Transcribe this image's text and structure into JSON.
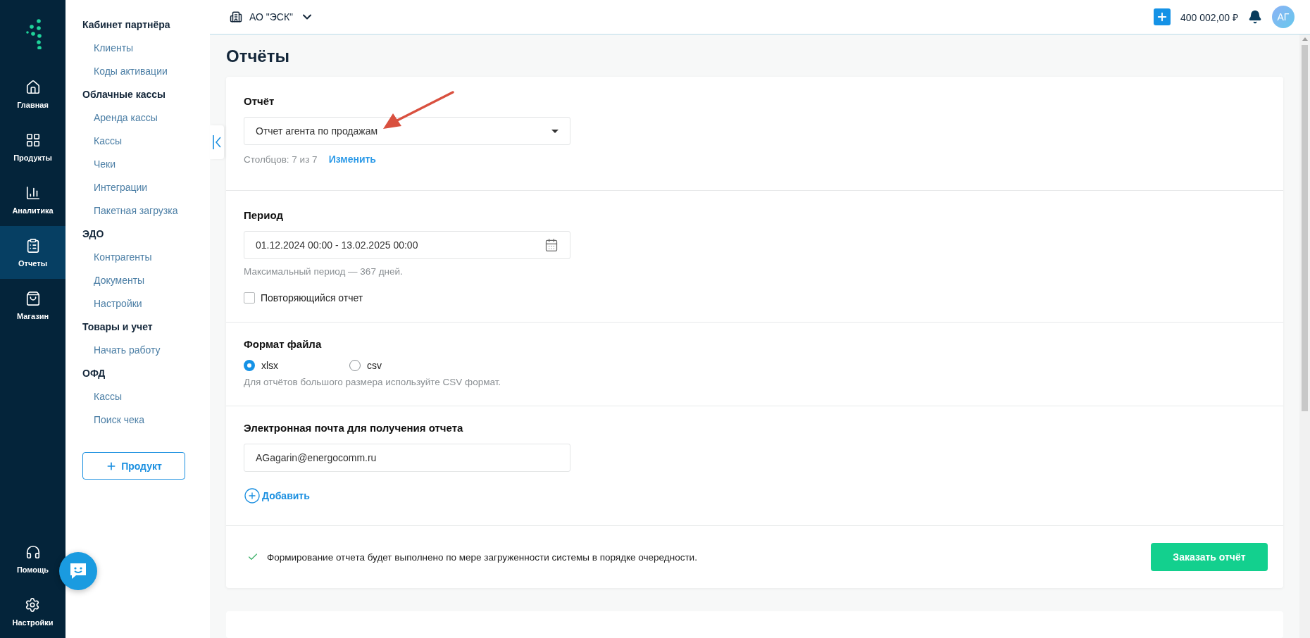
{
  "rail": {
    "items": [
      {
        "label": "Главная",
        "kind": "home",
        "selected": false
      },
      {
        "label": "Продукты",
        "kind": "grid",
        "selected": false
      },
      {
        "label": "Аналитика",
        "kind": "chart",
        "selected": false
      },
      {
        "label": "Отчеты",
        "kind": "clipboard",
        "selected": true
      },
      {
        "label": "Магазин",
        "kind": "bag",
        "selected": false
      }
    ],
    "bottom_items": [
      {
        "label": "Помощь",
        "kind": "headset"
      },
      {
        "label": "Настройки",
        "kind": "settings"
      }
    ]
  },
  "submenu": {
    "groups": [
      {
        "title": "Кабинет партнёра",
        "items": [
          {
            "label": "Клиенты"
          },
          {
            "label": "Коды активации"
          }
        ]
      },
      {
        "title": "Облачные кассы",
        "items": [
          {
            "label": "Аренда кассы"
          },
          {
            "label": "Кассы"
          },
          {
            "label": "Чеки"
          },
          {
            "label": "Интеграции"
          },
          {
            "label": "Пакетная загрузка"
          }
        ]
      },
      {
        "title": "ЭДО",
        "items": [
          {
            "label": "Контрагенты"
          },
          {
            "label": "Документы"
          },
          {
            "label": "Настройки"
          }
        ]
      },
      {
        "title": "Товары и учет",
        "items": [
          {
            "label": "Начать работу"
          }
        ]
      },
      {
        "title": "ОФД",
        "items": [
          {
            "label": "Кассы"
          },
          {
            "label": "Поиск чека"
          }
        ]
      }
    ],
    "add_button": "Продукт"
  },
  "topbar": {
    "company": "АО \"ЭСК\"",
    "balance": "400 002,00 ₽",
    "avatar": "АГ"
  },
  "page_title": "Отчёты",
  "report": {
    "label": "Отчёт",
    "value": "Отчет агента по продажам",
    "columns_info": "Столбцов: 7 из 7",
    "change_link": "Изменить"
  },
  "period": {
    "label": "Период",
    "value": "01.12.2024 00:00 - 13.02.2025 00:00",
    "hint": "Максимальный период — 367 дней.",
    "recurring": {
      "label": "Повторяющийся отчет",
      "checked": false
    }
  },
  "format": {
    "label": "Формат файла",
    "options": [
      {
        "label": "xlsx",
        "selected": true
      },
      {
        "label": "csv",
        "selected": false
      }
    ],
    "hint": "Для отчётов большого размера используйте CSV формат."
  },
  "email": {
    "label": "Электронная почта для получения отчета",
    "value": "AGagarin@energocomm.ru",
    "add_label": "Добавить"
  },
  "footer": {
    "note": "Формирование отчета будет выполнено по мере загруженности системы в порядке очередности.",
    "submit": "Заказать отчёт"
  }
}
